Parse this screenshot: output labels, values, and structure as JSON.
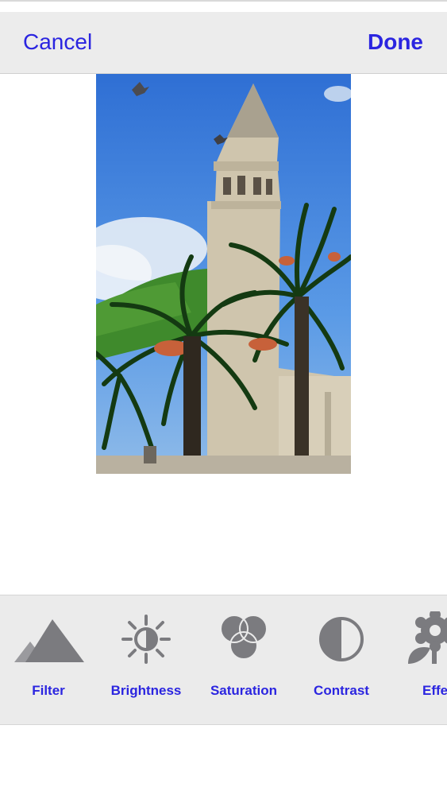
{
  "navbar": {
    "cancel_label": "Cancel",
    "done_label": "Done"
  },
  "toolbar": {
    "tools": [
      {
        "label": "Filter",
        "icon": "mountains-icon"
      },
      {
        "label": "Brightness",
        "icon": "sun-icon"
      },
      {
        "label": "Saturation",
        "icon": "overlapping-circles-icon"
      },
      {
        "label": "Contrast",
        "icon": "half-circle-icon"
      },
      {
        "label": "Effe",
        "icon": "flower-icon"
      }
    ]
  },
  "colors": {
    "accent": "#2b25e0",
    "bar_background": "#ececec",
    "icon_gray": "#7b7b7f"
  }
}
